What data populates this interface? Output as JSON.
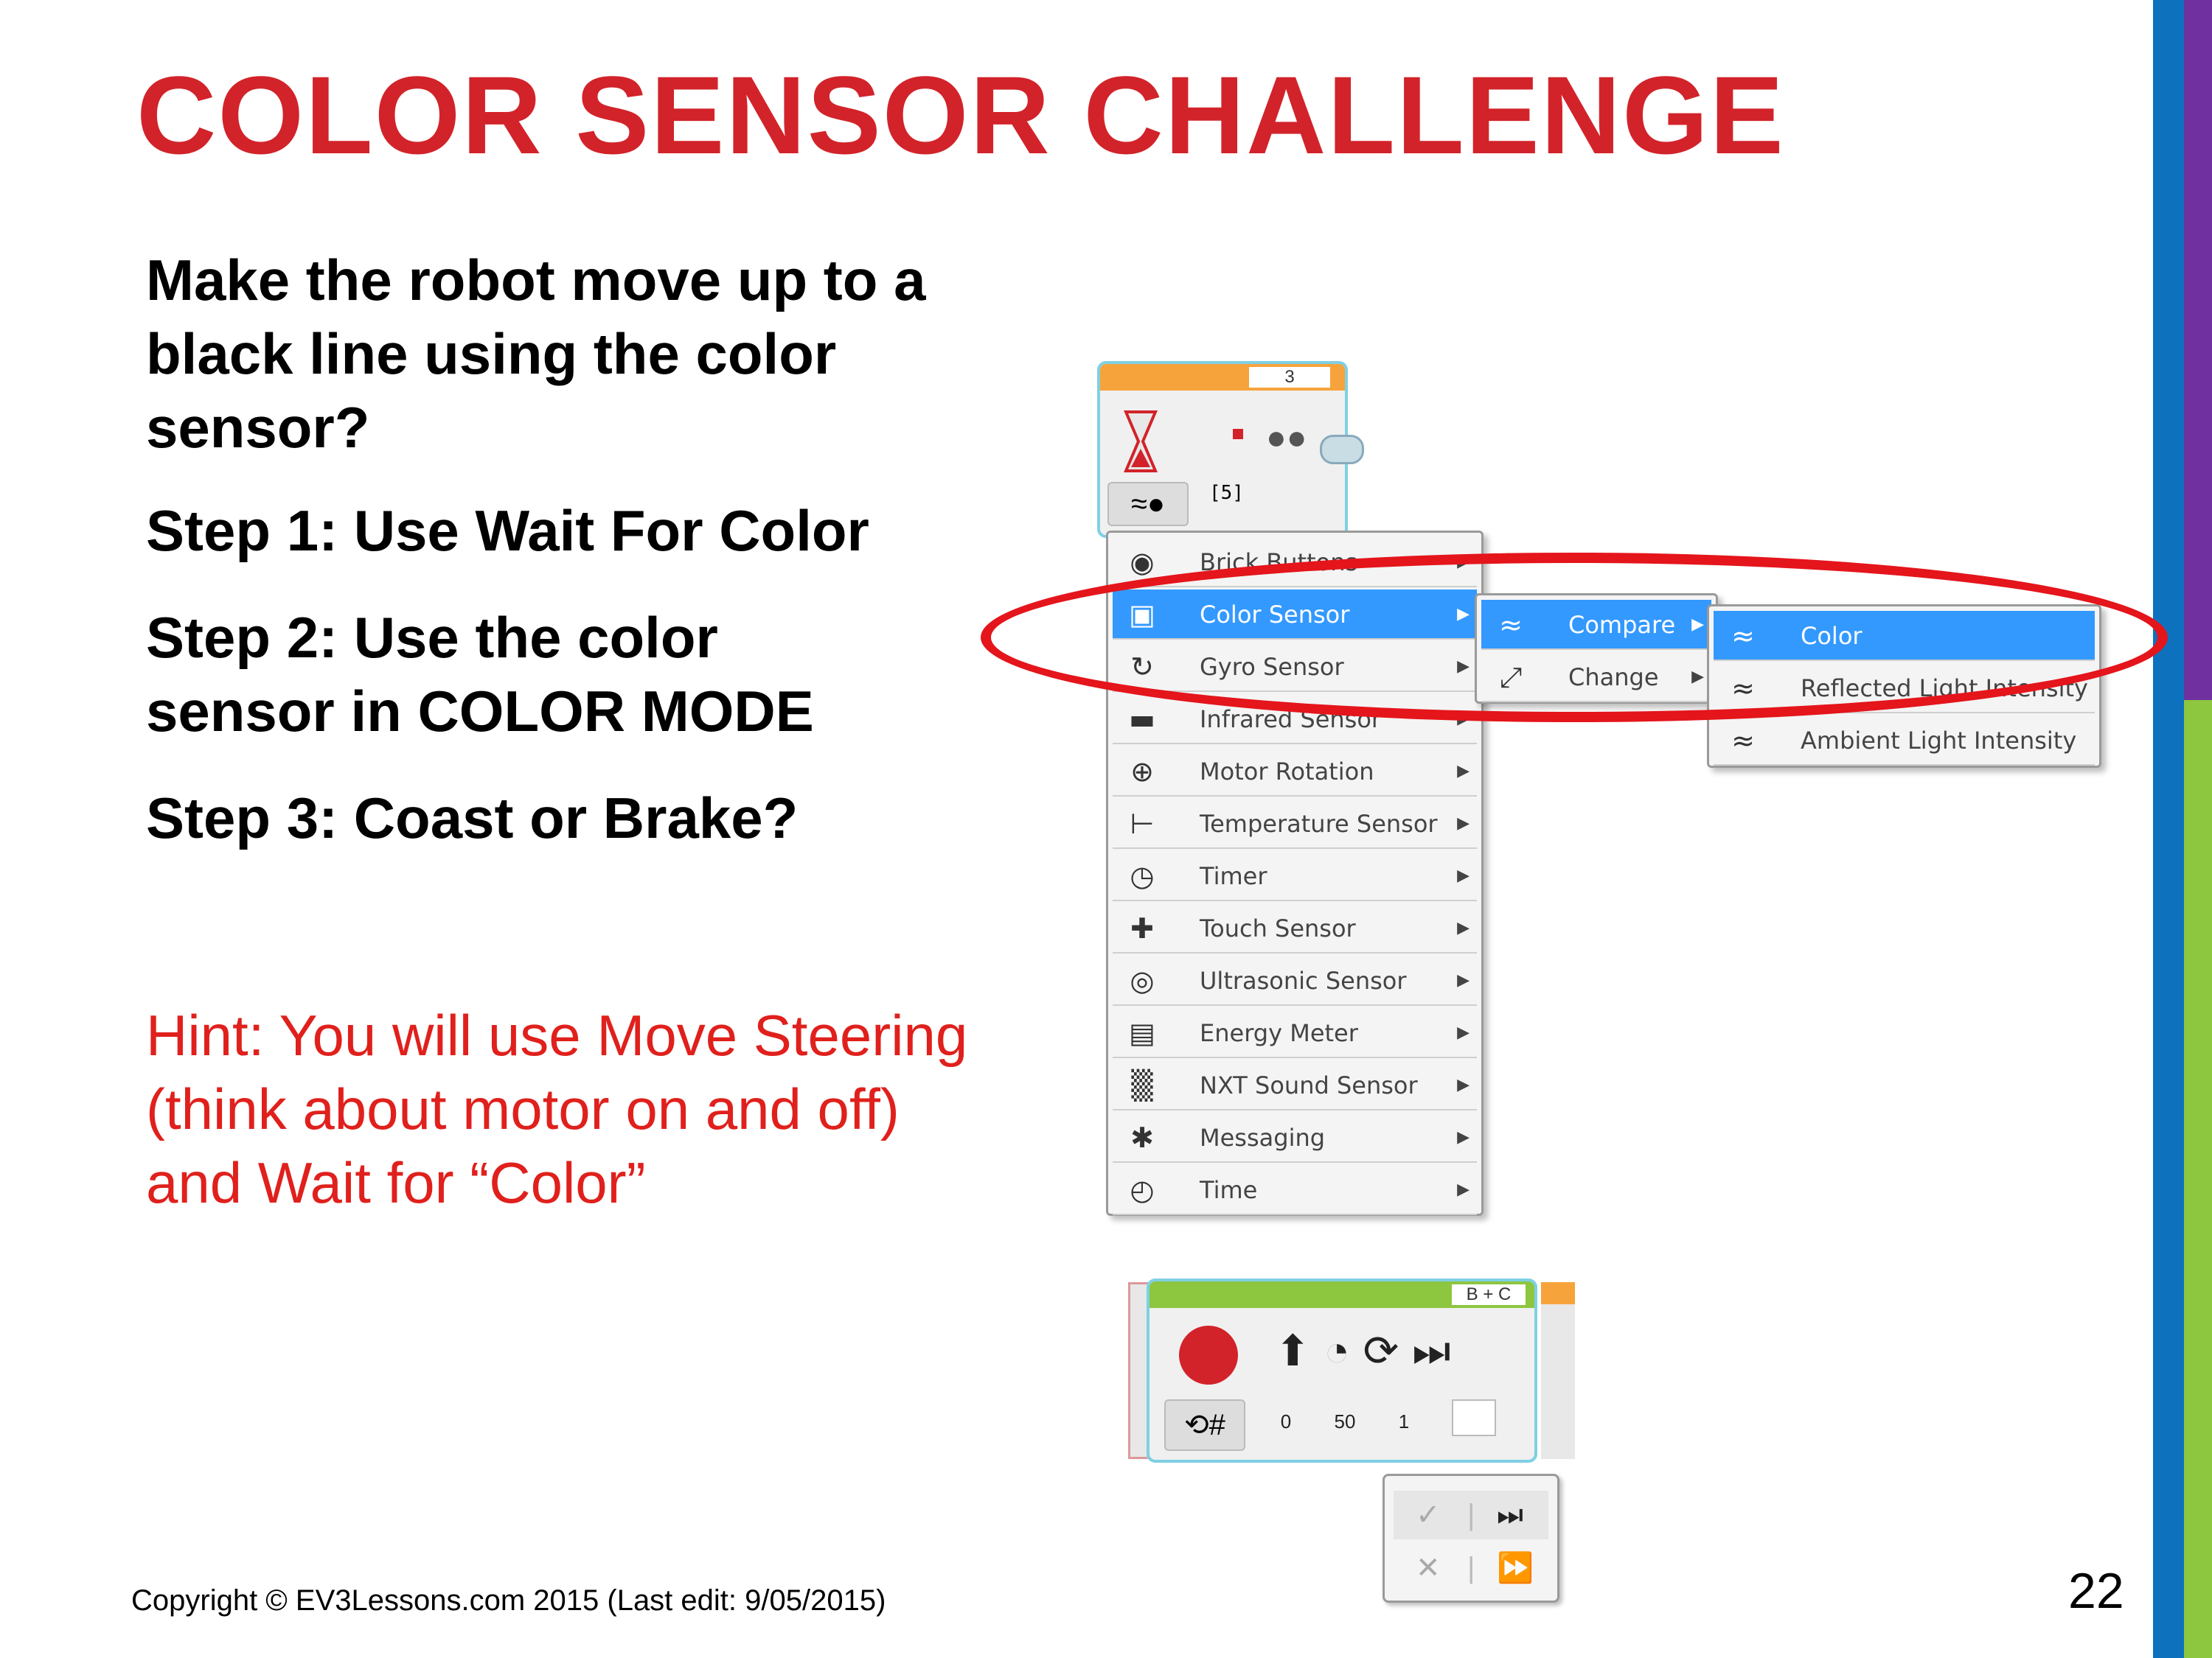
{
  "slide": {
    "title": "COLOR SENSOR CHALLENGE",
    "intro": "Make the robot move up to a black line using the color sensor?",
    "step1": "Step 1: Use Wait For Color",
    "step2": "Step 2: Use the color sensor in COLOR MODE",
    "step3": "Step 3: Coast or Brake?",
    "hint": "Hint: You will use Move Steering (think about motor on and off) and Wait for “Color”",
    "footer": "Copyright © EV3Lessons.com 2015 (Last edit: 9/05/2015)",
    "page_number": "22"
  },
  "wait_block": {
    "port": "3",
    "param": "[5]"
  },
  "main_menu": {
    "items": [
      {
        "label": "Brick Buttons",
        "icon": "brick-buttons-icon",
        "glyph": "◉"
      },
      {
        "label": "Color Sensor",
        "icon": "color-sensor-icon",
        "glyph": "▣"
      },
      {
        "label": "Gyro Sensor",
        "icon": "gyro-sensor-icon",
        "glyph": "↻"
      },
      {
        "label": "Infrared Sensor",
        "icon": "infrared-sensor-icon",
        "glyph": "▬"
      },
      {
        "label": "Motor Rotation",
        "icon": "motor-rotation-icon",
        "glyph": "⊕"
      },
      {
        "label": "Temperature Sensor",
        "icon": "temperature-sensor-icon",
        "glyph": "⊢"
      },
      {
        "label": "Timer",
        "icon": "timer-icon",
        "glyph": "◷"
      },
      {
        "label": "Touch Sensor",
        "icon": "touch-sensor-icon",
        "glyph": "✚"
      },
      {
        "label": "Ultrasonic Sensor",
        "icon": "ultrasonic-sensor-icon",
        "glyph": "◎"
      },
      {
        "label": "Energy Meter",
        "icon": "energy-meter-icon",
        "glyph": "▤"
      },
      {
        "label": "NXT Sound Sensor",
        "icon": "nxt-sound-sensor-icon",
        "glyph": "▒"
      },
      {
        "label": "Messaging",
        "icon": "messaging-icon",
        "glyph": "✱"
      },
      {
        "label": "Time",
        "icon": "time-icon",
        "glyph": "◴"
      }
    ],
    "active_index": 1
  },
  "sub_menu": {
    "items": [
      {
        "label": "Compare",
        "icon": "compare-icon",
        "glyph": "≈"
      },
      {
        "label": "Change",
        "icon": "change-icon",
        "glyph": "⤢"
      }
    ],
    "active_index": 0
  },
  "mode_menu": {
    "items": [
      {
        "label": "Color",
        "icon": "color-mode-icon",
        "glyph": "≈"
      },
      {
        "label": "Reflected Light Intensity",
        "icon": "reflected-light-icon",
        "glyph": "≈"
      },
      {
        "label": "Ambient Light Intensity",
        "icon": "ambient-light-icon",
        "glyph": "≈"
      }
    ],
    "active_index": 0
  },
  "move_block": {
    "ports": "B + C",
    "steering": "0",
    "power": "50",
    "rotations": "1"
  },
  "colors": {
    "title_red": "#d2232a",
    "hint_red": "#e0201c",
    "menu_highlight": "#3399ff",
    "ellipse_red": "#e4151b",
    "bar_blue": "#0e71bd",
    "bar_purple": "#7030a0",
    "bar_green": "#8dc63f"
  }
}
